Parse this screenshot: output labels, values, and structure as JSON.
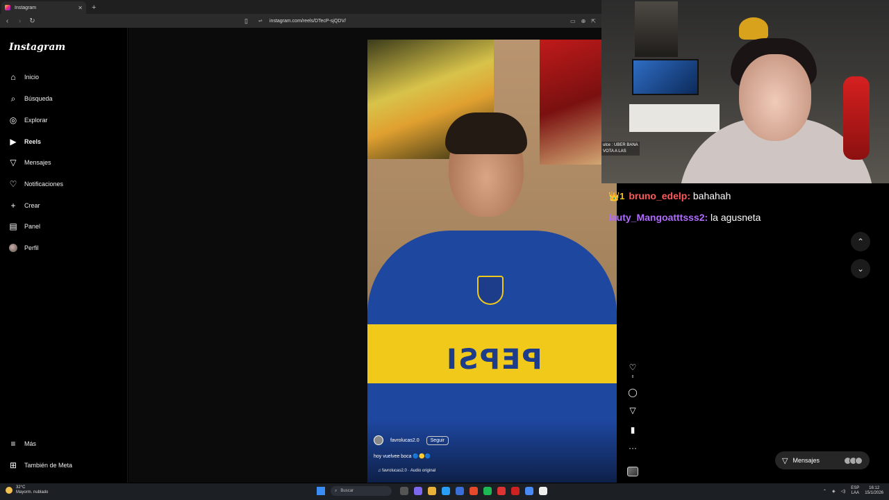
{
  "browser": {
    "tab_title": "Instagram",
    "tab_close": "✕",
    "new_tab": "+",
    "url": "instagram.com/reels/DTecP-sjQDV/"
  },
  "sidebar": {
    "logo": "Instagram",
    "items": [
      {
        "label": "Inicio",
        "icon": "home-icon"
      },
      {
        "label": "Búsqueda",
        "icon": "search-icon"
      },
      {
        "label": "Explorar",
        "icon": "compass-icon"
      },
      {
        "label": "Reels",
        "icon": "reels-icon"
      },
      {
        "label": "Mensajes",
        "icon": "send-icon"
      },
      {
        "label": "Notificaciones",
        "icon": "heart-icon"
      },
      {
        "label": "Crear",
        "icon": "plus-icon"
      },
      {
        "label": "Panel",
        "icon": "dashboard-icon"
      },
      {
        "label": "Perfil",
        "icon": "avatar-icon"
      }
    ],
    "bottom": [
      {
        "label": "Más",
        "icon": "menu-icon"
      },
      {
        "label": "También de Meta",
        "icon": "meta-grid-icon"
      }
    ]
  },
  "reel": {
    "username": "favrolucas2.0",
    "follow_label": "Seguir",
    "caption": "hoy vuelvee boca 🔵🟡🔵",
    "audio": "♫ favrolucas2.0 · Audio original",
    "jersey_text": "PEPSI",
    "likes": "8"
  },
  "stream": {
    "cam_chat_1": "ulce : UBER BANA",
    "cam_chat_2": "VOTA A LAS",
    "chat": [
      {
        "user": "bruno_edelp:",
        "message": "bahahah",
        "badge": "👑1"
      },
      {
        "user": "lauty_Mangoatttsss2:",
        "message": "la agusneta"
      }
    ]
  },
  "messages_pill": {
    "label": "Mensajes"
  },
  "taskbar": {
    "temp": "32°C",
    "weather": "Mayorm. nublado",
    "search_label": "Buscar",
    "lang_top": "ESP",
    "lang_bottom": "LAA",
    "time": "16:12",
    "date": "15/1/2026"
  },
  "colors": {
    "instagram_bg": "#000000",
    "chat_user_1": "#ff5a5a",
    "chat_user_2": "#b06bff"
  }
}
